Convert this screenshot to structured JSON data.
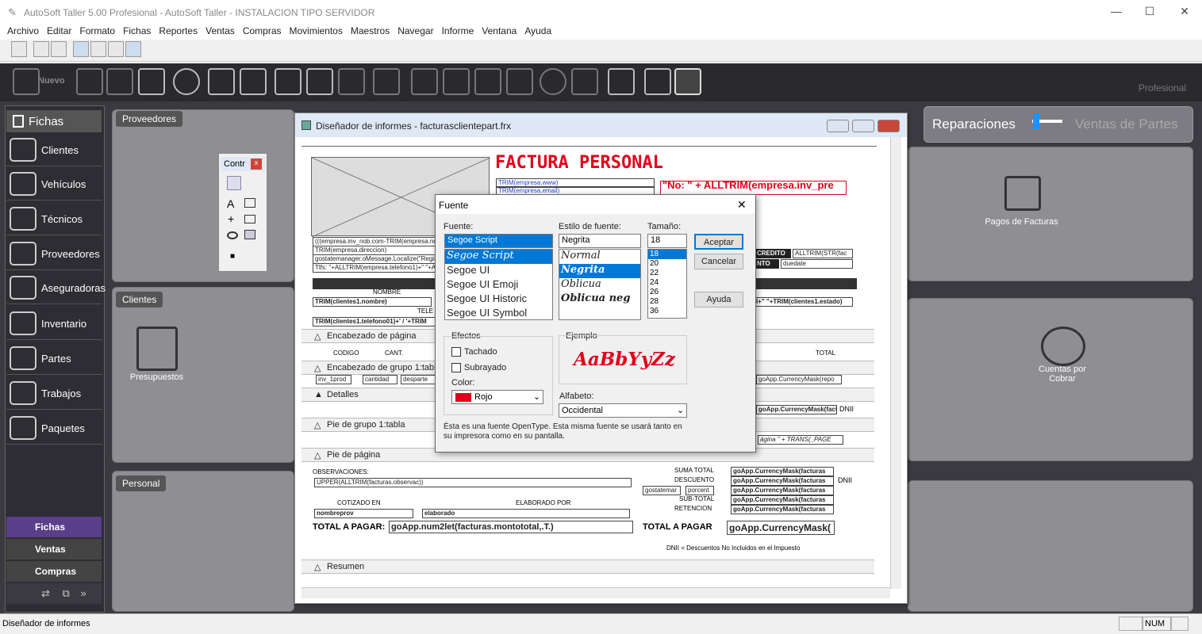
{
  "app": {
    "title": "AutoSoft Taller 5.00 Profesional - AutoSoft Taller - INSTALACION TIPO SERVIDOR",
    "brand": "Profesional"
  },
  "menu": [
    "Archivo",
    "Editar",
    "Formato",
    "Fichas",
    "Reportes",
    "Ventas",
    "Compras",
    "Movimientos",
    "Maestros",
    "Navegar",
    "Informe",
    "Ventana",
    "Ayuda"
  ],
  "toolbar": {
    "nuevo": "Nuevo"
  },
  "sidebar": {
    "header": "Fichas",
    "items": [
      {
        "label": "Clientes",
        "icon": "people-icon"
      },
      {
        "label": "Vehículos",
        "icon": "car-icon"
      },
      {
        "label": "Técnicos",
        "icon": "technician-icon"
      },
      {
        "label": "Proveedores",
        "icon": "truck-icon"
      },
      {
        "label": "Aseguradoras",
        "icon": "insurance-icon"
      },
      {
        "label": "Inventario",
        "icon": "inventory-icon"
      },
      {
        "label": "Partes",
        "icon": "engine-icon"
      },
      {
        "label": "Trabajos",
        "icon": "tools-icon"
      },
      {
        "label": "Paquetes",
        "icon": "package-icon"
      }
    ],
    "tabs": [
      "Fichas",
      "Ventas",
      "Compras"
    ]
  },
  "panels": {
    "proveedores": "Proveedores",
    "clientes": "Clientes",
    "personal": "Personal",
    "presupuestos": "Presupuestos",
    "pagos": "Pagos de Facturas",
    "cuentas": "Cuentas por Cobrar",
    "reparaciones": "Reparaciones",
    "ventas_partes": "Ventas de Partes"
  },
  "designer": {
    "title": "Diseñador de informes - facturasclientepart.frx",
    "report_title": "FACTURA PERSONAL",
    "no_field": "\"No: \" + ALLTRIM(empresa.inv_pre",
    "bands": [
      "Encabezado de página",
      "Encabezado de grupo 1:tabla",
      "Detalles",
      "Pie de grupo 1:tabla",
      "Pie de página",
      "Resumen"
    ],
    "fields": {
      "web": "TRIM(empresa.www)",
      "email": "TRIM(empresa.email)",
      "nombre_hdr": "NOMBRE",
      "nombre": "TRIM(clientes1.nombre)",
      "telefono": "TRIM(clientes1.telefono01)+' / '+TRIM",
      "tele_hdr": "TELE",
      "codigo": "CODIGO",
      "cant": "CANT.",
      "total": "TOTAL",
      "inv1prod": "inv_1prod",
      "cantidad": "cantidad",
      "desparte": "desparte",
      "currency": "goApp.CurrencyMask(repo",
      "currency2": "goApp.CurrencyMask(factur",
      "dnii": "DNII",
      "credito": "CREDITO",
      "alltrim_str": "ALLTRIM(STR(fac",
      "nto": "NTO",
      "duedate": "duedate",
      "estado": "l+\" \"+TRIM(clientes1.estado)",
      "pagina": "ágina \" + TRANS(_PAGE",
      "obs_hdr": "OBSERVACIONES:",
      "obs": "UPPER(ALLTRIM(facturas.observac))",
      "cotizado": "COTIZADO EN",
      "elaborado_por": "ELABORADO POR",
      "nombreprov": "nombreprov",
      "elaborado": "elaborado",
      "total_pagar": "TOTAL A PAGAR:",
      "num2let": "goApp.num2let(facturas.montototal,.T.)",
      "suma": "SUMA TOTAL",
      "descuento": "DESCUENTO",
      "subtotal": "SUB-TOTAL",
      "retencion": "RETENCION",
      "gostatemar": "gostatemar",
      "porcent": "porcent",
      "total_pagar2": "TOTAL A PAGAR",
      "cmask_f": "goApp.CurrencyMask(facturas",
      "cmask_big": "goApp.CurrencyMask(",
      "dnii_note": "DNII = Descuentos No Incluidos en el Impuesto",
      "emp_nombre": "(((empresa.inv_nob.com-TRIM(empresa.nomb",
      "emp_dir": "TRIM(empresa.direccion)",
      "loc": "gostatemanager.oMessage.Localize(\"Registro Fis",
      "tlf": "Tlfs: \"+ALLTRIM(empresa.telefono1)+\" \"+ALL"
    }
  },
  "toolbox": {
    "title": "Contr"
  },
  "font_dialog": {
    "title": "Fuente",
    "font_label": "Fuente:",
    "font_value": "Segoe Script",
    "fonts": [
      "Segoe Script",
      "Segoe UI",
      "Segoe UI Emoji",
      "Segoe UI Historic",
      "Segoe UI Symbol"
    ],
    "style_label": "Estilo de fuente:",
    "style_value": "Negrita",
    "styles": [
      "Normal",
      "Negrita",
      "Oblicua",
      "Oblicua neg"
    ],
    "size_label": "Tamaño:",
    "size_value": "18",
    "sizes": [
      "18",
      "20",
      "22",
      "24",
      "26",
      "28",
      "36"
    ],
    "ok": "Aceptar",
    "cancel": "Cancelar",
    "help": "Ayuda",
    "effects": "Efectos",
    "strike": "Tachado",
    "underline": "Subrayado",
    "color_label": "Color:",
    "color": "Rojo",
    "sample_label": "Ejemplo",
    "sample": "AaBbYyZz",
    "script_label": "Alfabeto:",
    "script": "Occidental",
    "note": "Ésta es una fuente OpenType. Esta misma fuente se usará tanto en su impresora como en su pantalla."
  },
  "status": {
    "text": "Diseñador de informes",
    "num": "NUM"
  },
  "colors": {
    "accent": "#e0001b",
    "sidebar": "#2d2d33",
    "panel": "#8e8e93",
    "select": "#0078d7"
  }
}
